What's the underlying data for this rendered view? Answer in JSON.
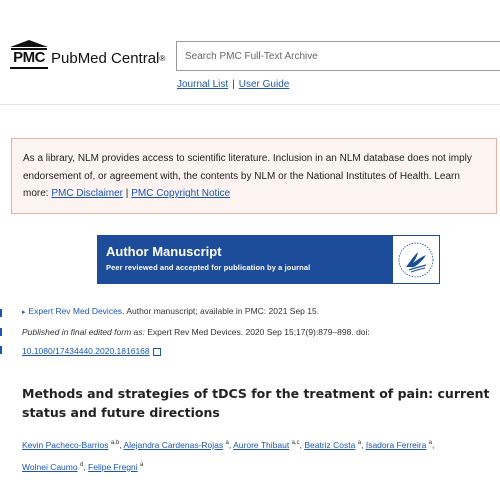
{
  "header": {
    "logo_mark": "PMC",
    "logo_name": "PubMed Central",
    "logo_reg": "®",
    "search_placeholder": "Search PMC Full-Text Archive",
    "links": [
      {
        "label": "Journal List"
      },
      {
        "label": "User Guide"
      }
    ],
    "link_sep": "|"
  },
  "disclaimer": {
    "text": "As a library, NLM provides access to scientific literature. Inclusion in an NLM database does not imply endorsement of, or agreement with, the contents by NLM or the National Institutes of Health.",
    "learn_more": "Learn more:",
    "link1": "PMC Disclaimer",
    "sep": "|",
    "link2": "PMC Copyright Notice"
  },
  "banner": {
    "title": "Author Manuscript",
    "subtitle": "Peer reviewed and accepted for publication by a journal"
  },
  "citation": {
    "journal": "Expert Rev Med Devices",
    "line1_rest": ". Author manuscript; available in PMC: 2021 Sep 15.",
    "published_label": "Published in final edited form as:",
    "published_rest": " Expert Rev Med Devices. 2020 Sep 15;17(9):879–898. doi: ",
    "doi": "10.1080/17434440.2020.1816168"
  },
  "article": {
    "title": "Methods and strategies of tDCS for the treatment of pain: current status and future directions",
    "authors": [
      {
        "name": "Kevin Pacheco-Barrios",
        "sup": "a,b"
      },
      {
        "name": "Alejandra Cardenas-Rojas",
        "sup": "a"
      },
      {
        "name": "Aurore Thibaut",
        "sup": "a,c"
      },
      {
        "name": "Beatriz Costa",
        "sup": "a"
      },
      {
        "name": "Isadora Ferreira",
        "sup": "a"
      },
      {
        "name": "Wolnei Caumo",
        "sup": "d"
      },
      {
        "name": "Felipe Fregni",
        "sup": "a"
      }
    ]
  },
  "colors": {
    "link": "#1a56b8",
    "banner_bg": "#1d4d9a",
    "disclaimer_border": "#e8b0a0",
    "disclaimer_bg": "#fdf4f1"
  }
}
